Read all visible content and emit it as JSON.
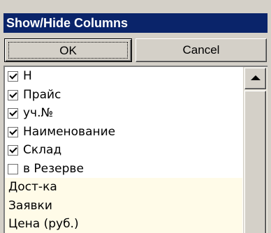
{
  "window": {
    "title": "Show/Hide Columns"
  },
  "buttons": {
    "ok_label": "OK",
    "cancel_label": "Cancel"
  },
  "columns": [
    {
      "label": "Н",
      "checked": true
    },
    {
      "label": "Прайс",
      "checked": true
    },
    {
      "label": "уч.№",
      "checked": true
    },
    {
      "label": "Наименование",
      "checked": true
    },
    {
      "label": "Склад",
      "checked": true
    },
    {
      "label": "в Резерве",
      "checked": false
    }
  ],
  "other_columns": [
    "Дост-ка",
    "Заявки",
    "Цена (руб.)"
  ],
  "colors": {
    "titlebar": "#0a246a",
    "face": "#d4d0c8",
    "unselectable_row_bg": "#fffbe8"
  }
}
